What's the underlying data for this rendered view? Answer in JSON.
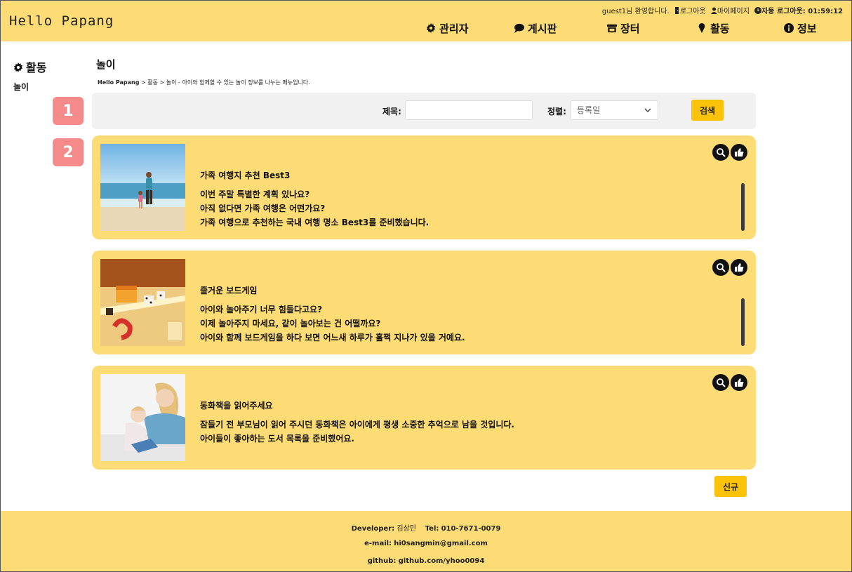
{
  "header": {
    "logo": "Hello Papang",
    "user_greeting": "guest1님 환영합니다.",
    "logout": "로그아웃",
    "mypage": "마이페이지",
    "auto_logout": "자동 로그아웃: 01:59:12",
    "nav": [
      {
        "label": "관리자",
        "icon": "gear-icon"
      },
      {
        "label": "게시판",
        "icon": "chat-bubble-icon"
      },
      {
        "label": "장터",
        "icon": "shop-icon"
      },
      {
        "label": "활동",
        "icon": "ice-cream-icon"
      },
      {
        "label": "정보",
        "icon": "info-icon"
      }
    ]
  },
  "sidebar": {
    "title": "활동",
    "items": [
      "놀이"
    ]
  },
  "main": {
    "title": "놀이",
    "breadcrumb": {
      "home": "Hello Papang",
      "path": " > 활동 > 놀이 - 아이와 함께할 수 있는 놀이 정보를 나누는 메뉴입니다."
    },
    "markers": [
      "1",
      "2"
    ],
    "search": {
      "title_label": "제목:",
      "title_value": "",
      "sort_label": "정렬:",
      "sort_selected": "등록일",
      "search_button": "검색"
    },
    "posts": [
      {
        "title": "가족 여행지 추천 Best3",
        "lines": [
          "이번 주말 특별한 계획 있나요?",
          "아직 없다면 가족 여행은 어떤가요?",
          "가족 여행으로 추천하는 국내 여행 명소 Best3를 준비했습니다."
        ]
      },
      {
        "title": "즐거운 보드게임",
        "lines": [
          "아이와 놀아주기 너무 힘들다고요?",
          "이제 놀아주지 마세요, 같이 놀아보는 건 어떨까요?",
          "아이와 함께 보드게임을 하다 보면 어느새 하루가 훌쩍 지나가 있을 거예요."
        ]
      },
      {
        "title": "동화책을 읽어주세요",
        "lines": [
          "잠들기 전 부모님이 읽어 주시던 동화책은 아이에게 평생 소중한 추억으로 남을 것입니다.",
          "아이들이 좋아하는 도서 목록을 준비했어요."
        ]
      }
    ],
    "new_button": "신규"
  },
  "footer": {
    "developer_label": "Developer:",
    "developer_name": "김상민",
    "tel_label": "Tel:",
    "tel": "010-7671-0079",
    "email_label": "e-mail:",
    "email": "hi0sangmin@gmail.com",
    "github_label": "github:",
    "github": "github.com/yhoo0094"
  },
  "colors": {
    "header_bg": "#fddb75",
    "button": "#fbc20a",
    "marker": "#f48a8a",
    "card_bg": "#fddb75"
  }
}
